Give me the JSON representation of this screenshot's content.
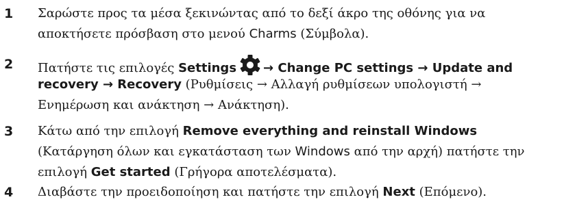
{
  "steps": [
    {
      "number": "1",
      "line1_a": "Σαρώστε προς τα μέσα ξεκινώντας από το δεξί άκρο της οθόνης για να",
      "line2_a": "αποκτήσετε πρόσβαση στο μενού ",
      "line2_latin": "Charms",
      "line2_b": " (Σύμβολα)."
    },
    {
      "number": "2",
      "line1_a": "Πατήστε τις επιλογές ",
      "settings": "Settings",
      "icon": "gear-icon",
      "line1_ui": "→ Change PC settings → Update and",
      "line2_ui": "recovery → Recovery",
      "line2_b": " (Ρυθμίσεις → Αλλαγή ρυθμίσεων υπολογιστή →",
      "line3_a": "Ενημέρωση και ανάκτηση → Ανάκτηση)."
    },
    {
      "number": "3",
      "line1_a": "Κάτω από την επιλογή ",
      "line1_ui": "Remove everything and reinstall Windows",
      "line2_a": "(Κατάργηση όλων και εγκατάσταση των ",
      "line2_latin": "Windows",
      "line2_b": " από την αρχή) πατήστε την",
      "line3_a": "επιλογή ",
      "line3_ui": "Get started",
      "line3_b": " (Γρήγορα αποτελέσματα)."
    },
    {
      "number": "4",
      "line1_a": "Διαβάστε την προειδοποίηση και πατήστε την επιλογή ",
      "line1_ui": "Next",
      "line1_b": " (Επόμενο)."
    }
  ]
}
